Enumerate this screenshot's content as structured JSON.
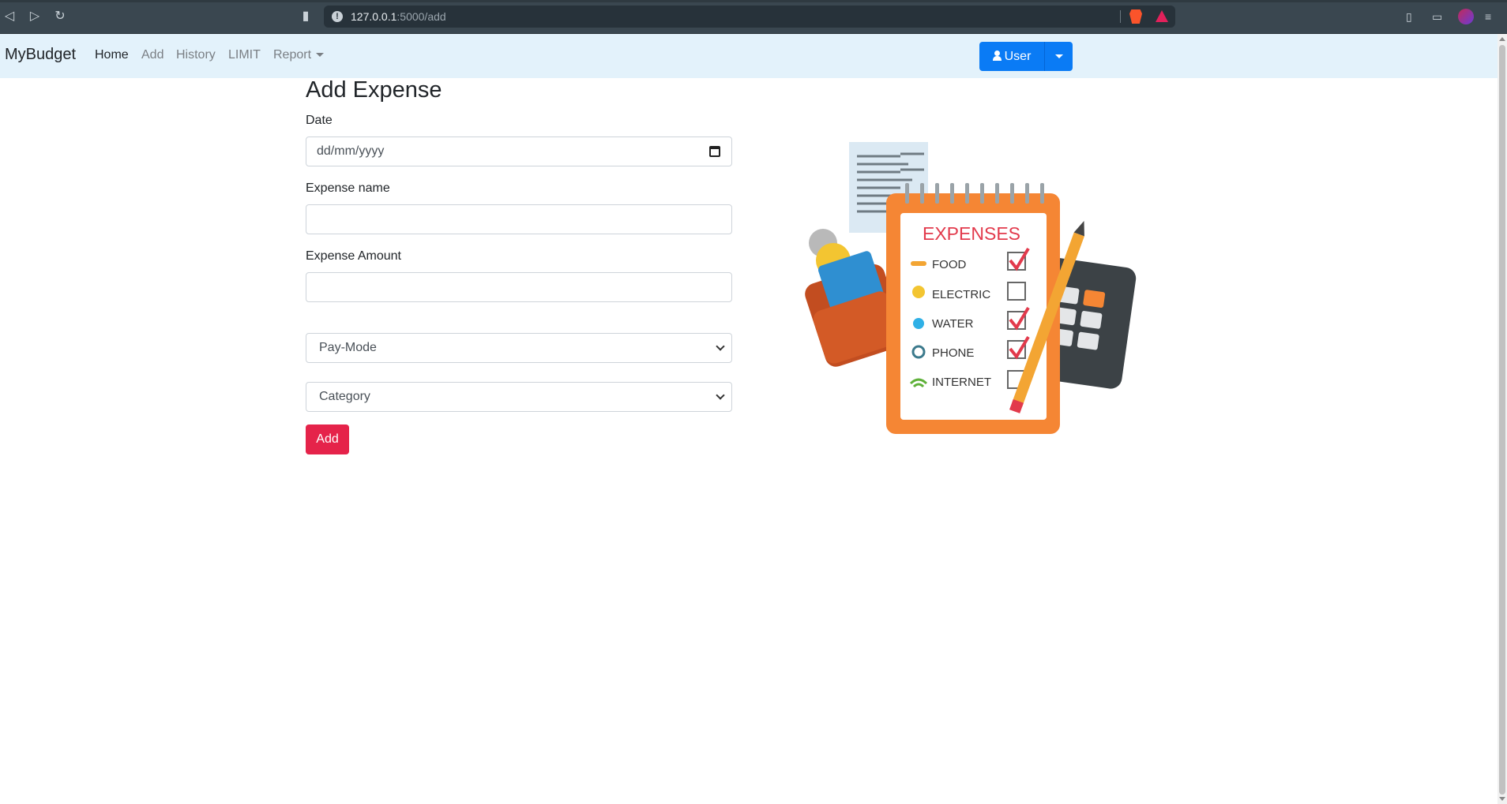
{
  "browser": {
    "url_host": "127.0.0.1",
    "url_path": ":5000/add"
  },
  "navbar": {
    "brand": "MyBudget",
    "links": [
      "Home",
      "Add",
      "History",
      "LIMIT",
      "Report"
    ],
    "user_button": "User"
  },
  "form": {
    "title": "Add Expense",
    "date_label": "Date",
    "date_placeholder": "dd/mm/yyyy",
    "name_label": "Expense name",
    "amount_label": "Expense Amount",
    "paymode_select": "Pay-Mode",
    "category_select": "Category",
    "submit_label": "Add"
  },
  "illustration": {
    "heading": "EXPENSES",
    "items": [
      {
        "label": "FOOD",
        "checked": true
      },
      {
        "label": "ELECTRIC",
        "checked": false
      },
      {
        "label": "WATER",
        "checked": true
      },
      {
        "label": "PHONE",
        "checked": true
      },
      {
        "label": "INTERNET",
        "checked": false
      }
    ]
  },
  "colors": {
    "navbar_bg": "#e3f2fb",
    "primary": "#0a7bf5",
    "danger": "#e5234a",
    "notepad": "#f58634"
  }
}
